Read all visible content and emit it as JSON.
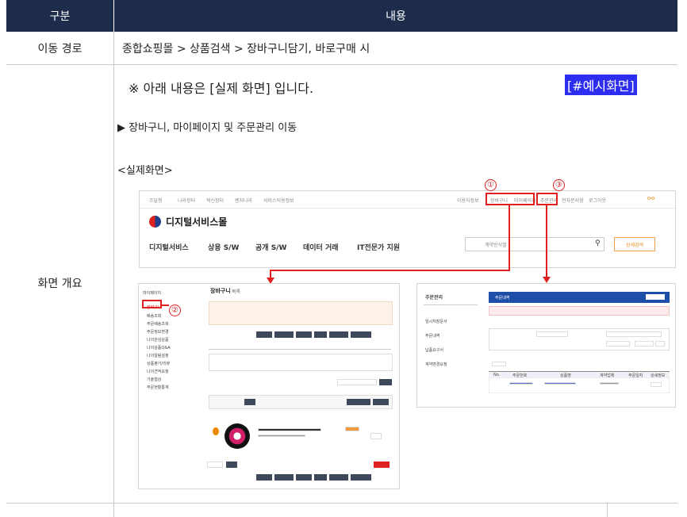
{
  "table": {
    "header": {
      "col1": "구분",
      "col2": "내용"
    },
    "path_row": {
      "label": "이동 경로",
      "value": "종합쇼핑몰 > 상품검색 > 장바구니담기, 바로구매 시"
    },
    "overview_row": {
      "label": "화면 개요"
    }
  },
  "content": {
    "note": "※ 아래 내용은 [실제 화면] 입니다.",
    "tag": "[#예시화면]",
    "move": "▶ 장바구니, 마이페이지 및 주문관리 이동",
    "real_label": "<실제화면>"
  },
  "screenshot": {
    "topnav": [
      "조달청",
      "나라장터",
      "혁신장터",
      "벤처나라",
      "서비스이용정보"
    ],
    "topnav_right": [
      "이용자정보",
      "장바구니",
      "마이페이지",
      "주문관리",
      "전자문서함",
      "로그아웃"
    ],
    "logo": "디지털서비스몰",
    "menu": [
      "디지털서비스",
      "상용 S/W",
      "공개 S/W",
      "데이터 거래",
      "IT전문가 지원"
    ],
    "search_placeholder": "계약방식별",
    "detail_search": "상세검색",
    "markers": [
      "①",
      "②",
      "③"
    ],
    "cart_title": "장바구니",
    "cart_title_sub": "목록",
    "mypage": "마이페이지",
    "side_items": [
      "장바구니",
      "배송조회",
      "주문배송조회",
      "주문정보변경",
      "나의관심상품",
      "나의상품Q&A",
      "나의알림설정",
      "상품평가/리뷰",
      "나의견적요청",
      "기술협상",
      "주문현황통계"
    ],
    "order_title": "주문관리",
    "order_side": [
      "임시저장문서",
      "주문내역",
      "납품요구서",
      "계약변경요청"
    ],
    "order_header": "주문내역",
    "order_cols": [
      "No.",
      "주문번호",
      "상품명",
      "계약업체",
      "주문일자",
      "상세정보"
    ]
  },
  "colors": {
    "header_bg": "#1c2c4a",
    "accent": "#e02020",
    "tag_bg": "#2d2df0"
  }
}
